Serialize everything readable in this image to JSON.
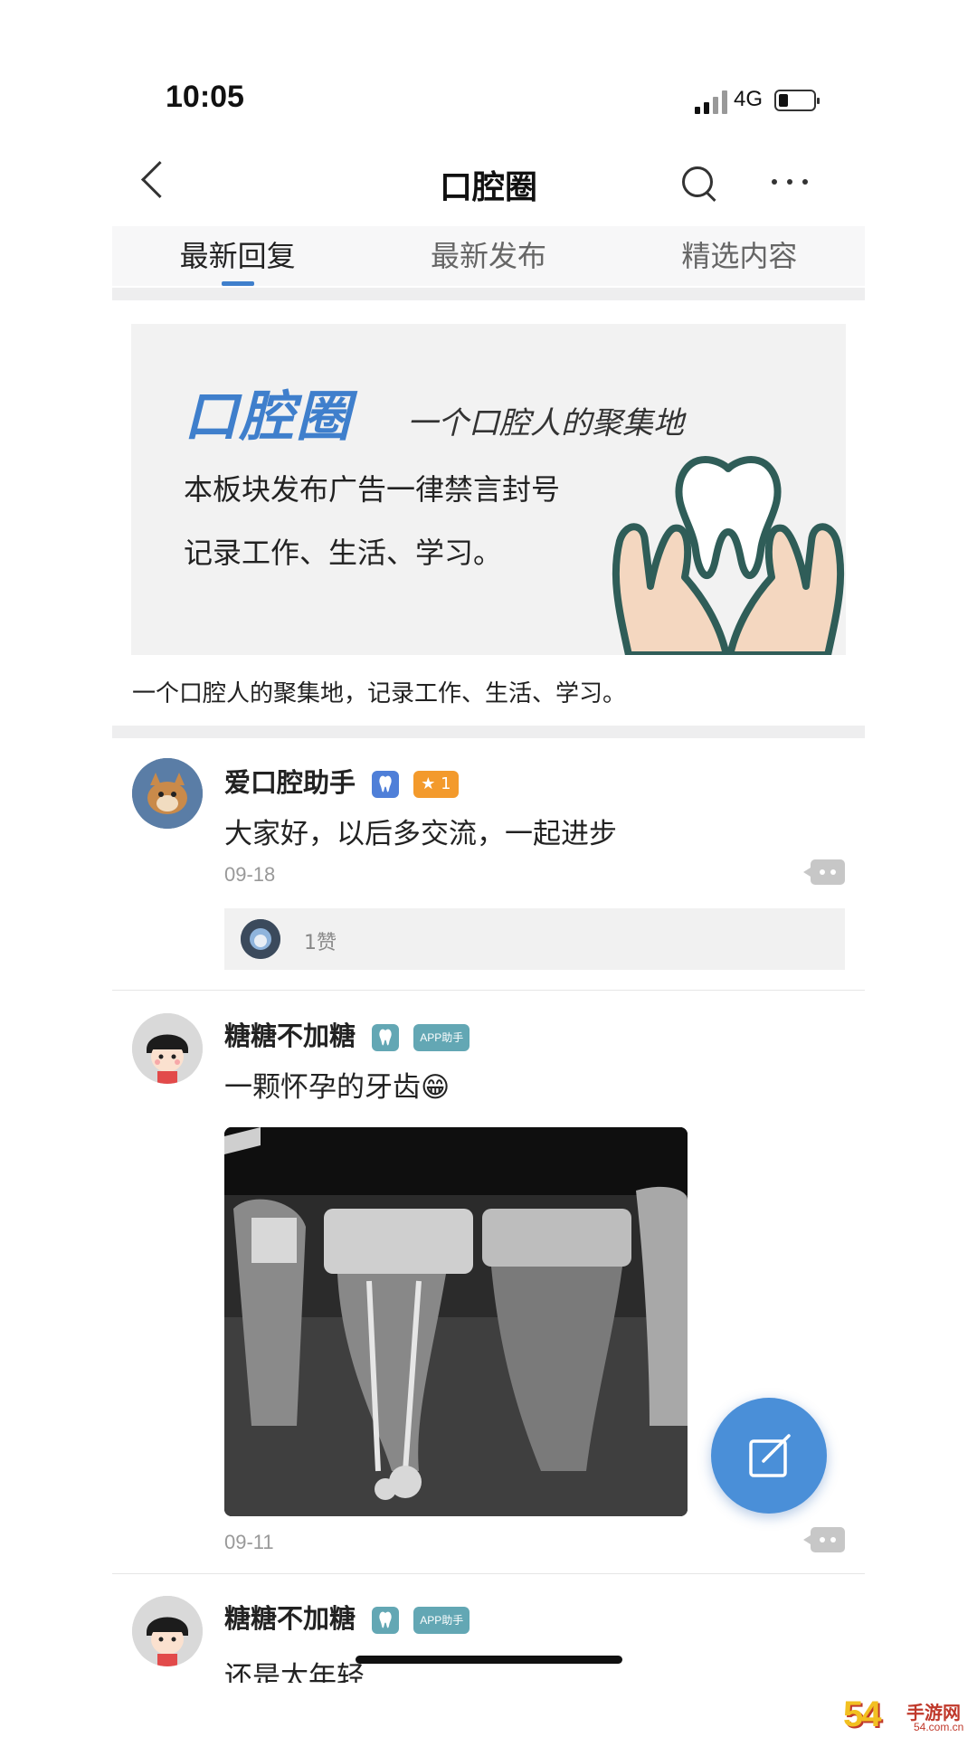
{
  "status_bar": {
    "time": "10:05",
    "network": "4G"
  },
  "nav": {
    "title": "口腔圈"
  },
  "tabs": [
    {
      "label": "最新回复",
      "active": true
    },
    {
      "label": "最新发布",
      "active": false
    },
    {
      "label": "精选内容",
      "active": false
    }
  ],
  "banner": {
    "logo_text": "口腔圈",
    "slogan": "一个口腔人的聚集地",
    "line1": "本板块发布广告一律禁言封号",
    "line2": "记录工作、生活、学习。"
  },
  "caption": "一个口腔人的聚集地，记录工作、生活、学习。",
  "posts": [
    {
      "username": "爱口腔助手",
      "level": "★ 1",
      "text": "大家好，以后多交流，一起进步",
      "date": "09-18",
      "likes_text": "1赞"
    },
    {
      "username": "糖糖不加糖",
      "badge": "APP助手",
      "text": "一颗怀孕的牙齿",
      "emoji": "😁",
      "date": "09-11"
    },
    {
      "username": "糖糖不加糖",
      "badge": "APP助手",
      "text": "还是太年轻"
    }
  ],
  "watermark": {
    "number": "54",
    "text": "手游网",
    "sub": "54.com.cn"
  },
  "colors": {
    "accent": "#3f7fcc",
    "fab": "#4a8fd8",
    "star_badge": "#f39a2c",
    "app_badge": "#63a7b4"
  }
}
